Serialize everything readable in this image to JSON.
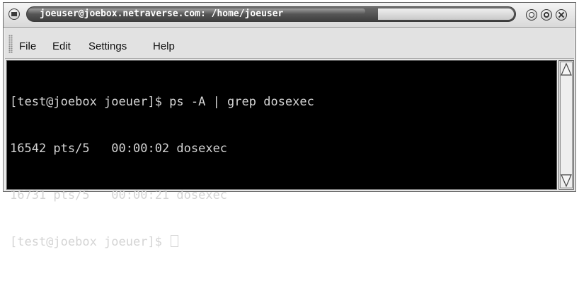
{
  "window": {
    "title": "joeuser@joebox.netraverse.com: /home/joeuser"
  },
  "menubar": {
    "items": [
      {
        "label": "File"
      },
      {
        "label": "Edit"
      },
      {
        "label": "Settings"
      },
      {
        "label": "Help"
      }
    ]
  },
  "terminal": {
    "lines": [
      "[test@joebox joeuer]$ ps -A | grep dosexec",
      "16542 pts/5   00:00:02 dosexec",
      "16731 pts/5   00:00:21 dosexec",
      "[test@joebox joeuer]$ "
    ]
  },
  "icons": {
    "window_menu": "window-menu-icon",
    "minimize": "minimize-icon",
    "maximize": "maximize-icon",
    "close": "close-icon",
    "scroll_up": "arrow-up-icon",
    "scroll_down": "arrow-down-icon"
  },
  "colors": {
    "terminal_bg": "#000000",
    "terminal_fg": "#d4d4d4",
    "titlebar": "#4a4a4a",
    "chrome": "#e2e2e2"
  }
}
